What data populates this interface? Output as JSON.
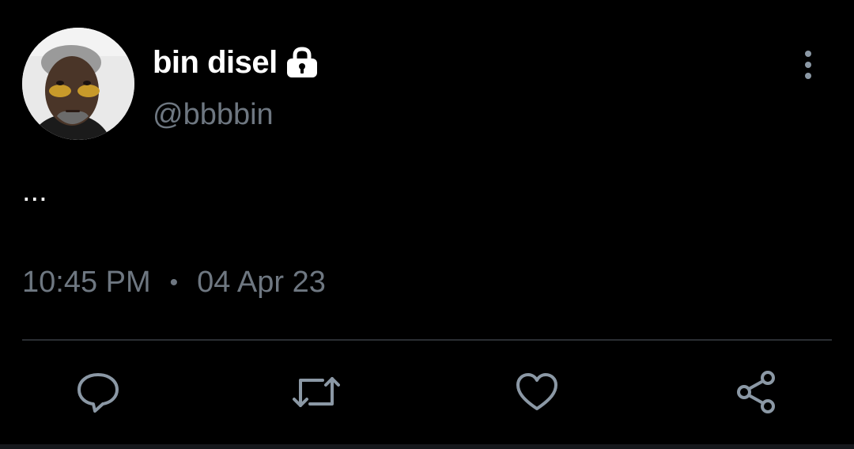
{
  "user": {
    "display_name": "bin disel",
    "handle": "@bbbbin",
    "protected_icon": "lock-icon",
    "avatar_icon": "profile-photo"
  },
  "tweet": {
    "text": "...",
    "time": "10:45 PM",
    "separator": "•",
    "date": "04 Apr 23"
  },
  "header": {
    "more_icon": "vertical-ellipsis-icon"
  },
  "actions": [
    {
      "name": "reply",
      "icon": "speech-bubble-icon"
    },
    {
      "name": "retweet",
      "icon": "retweet-icon"
    },
    {
      "name": "like",
      "icon": "heart-icon"
    },
    {
      "name": "share",
      "icon": "share-icon"
    }
  ],
  "colors": {
    "background": "#000000",
    "primary_text": "#ffffff",
    "secondary_text": "#6e7781",
    "icon": "#8b98a5",
    "divider": "#2a2e33"
  }
}
